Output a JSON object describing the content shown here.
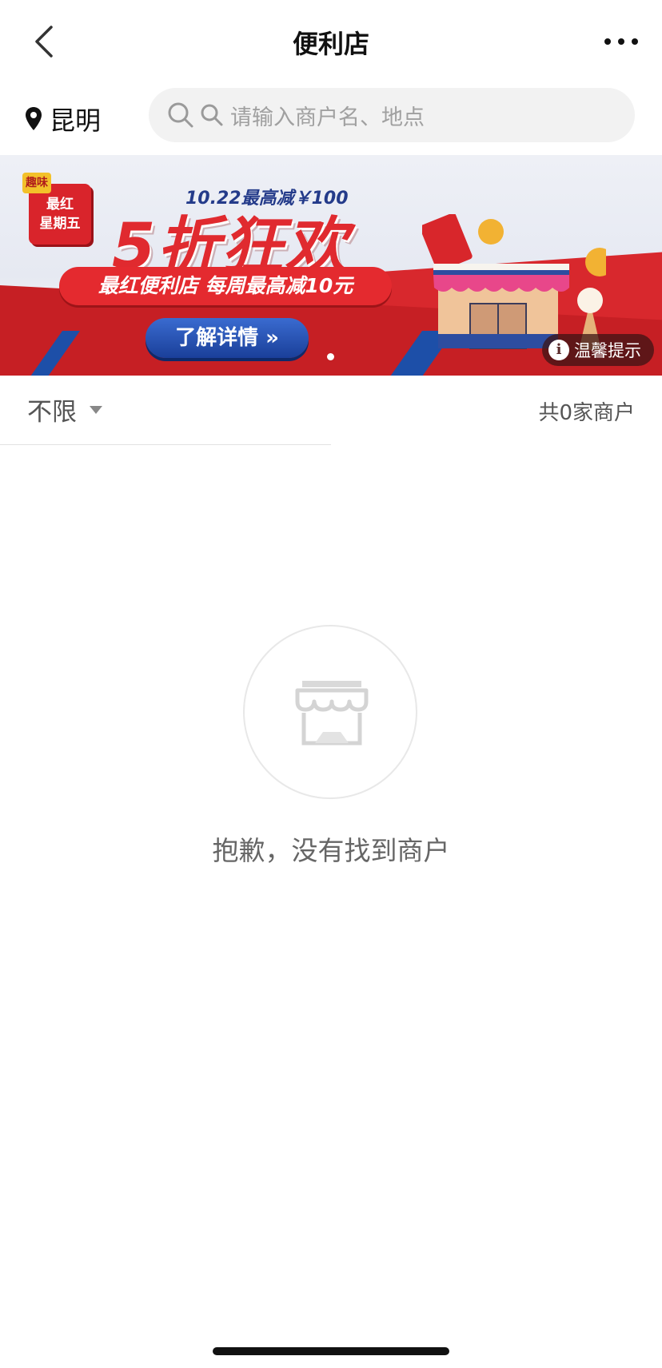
{
  "nav": {
    "title": "便利店"
  },
  "location": {
    "city": "昆明"
  },
  "search": {
    "placeholder": "请输入商户名、地点"
  },
  "banner": {
    "badge_tag": "趣味",
    "badge_text": "最红\n星期五",
    "subtitle": "10.22最高减￥100",
    "title": "5折狂欢",
    "ribbon": "最红便利店  每周最高减10元",
    "cta": "了解详情 »",
    "tip_label": "温馨提示",
    "tip_icon": "i",
    "page_count": 1,
    "active_page": 1
  },
  "filter": {
    "label": "不限",
    "count_text": "共0家商户"
  },
  "empty": {
    "message": "抱歉，没有找到商户"
  },
  "colors": {
    "brand_red": "#e02a2f",
    "cta_blue": "#1a3f99"
  }
}
